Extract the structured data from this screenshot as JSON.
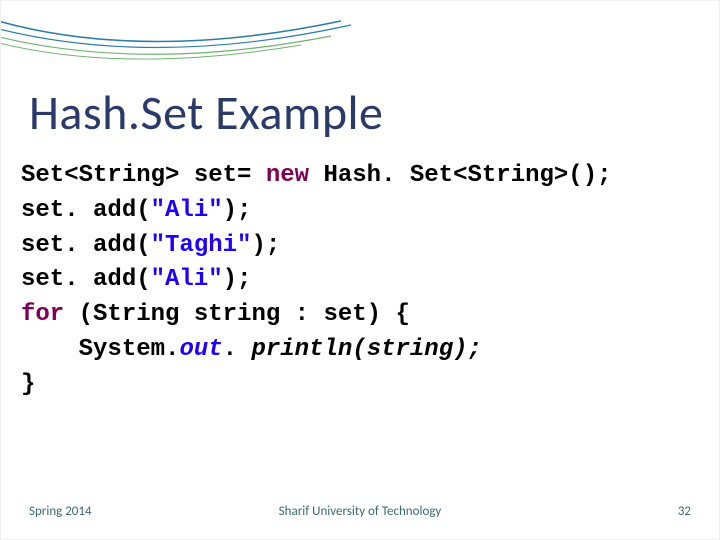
{
  "title": "Hash.Set Example",
  "code": {
    "l1a": "Set<String> set= ",
    "l1b": "new",
    "l1c": " Hash. Set<String>();",
    "l2a": "set. add(",
    "l2b": "\"Ali\"",
    "l2c": ");",
    "l3a": "set. add(",
    "l3b": "\"Taghi\"",
    "l3c": ");",
    "l4a": "set. add(",
    "l4b": "\"Ali\"",
    "l4c": ");",
    "l5a": "for",
    "l5b": " (String string : set) {",
    "l6a": "    System.",
    "l6b": "out",
    "l6c": ".",
    "l6d": "println(string);",
    "l7": "}"
  },
  "footer": {
    "left": "Spring 2014",
    "center": "Sharif University of Technology",
    "right": "32"
  }
}
